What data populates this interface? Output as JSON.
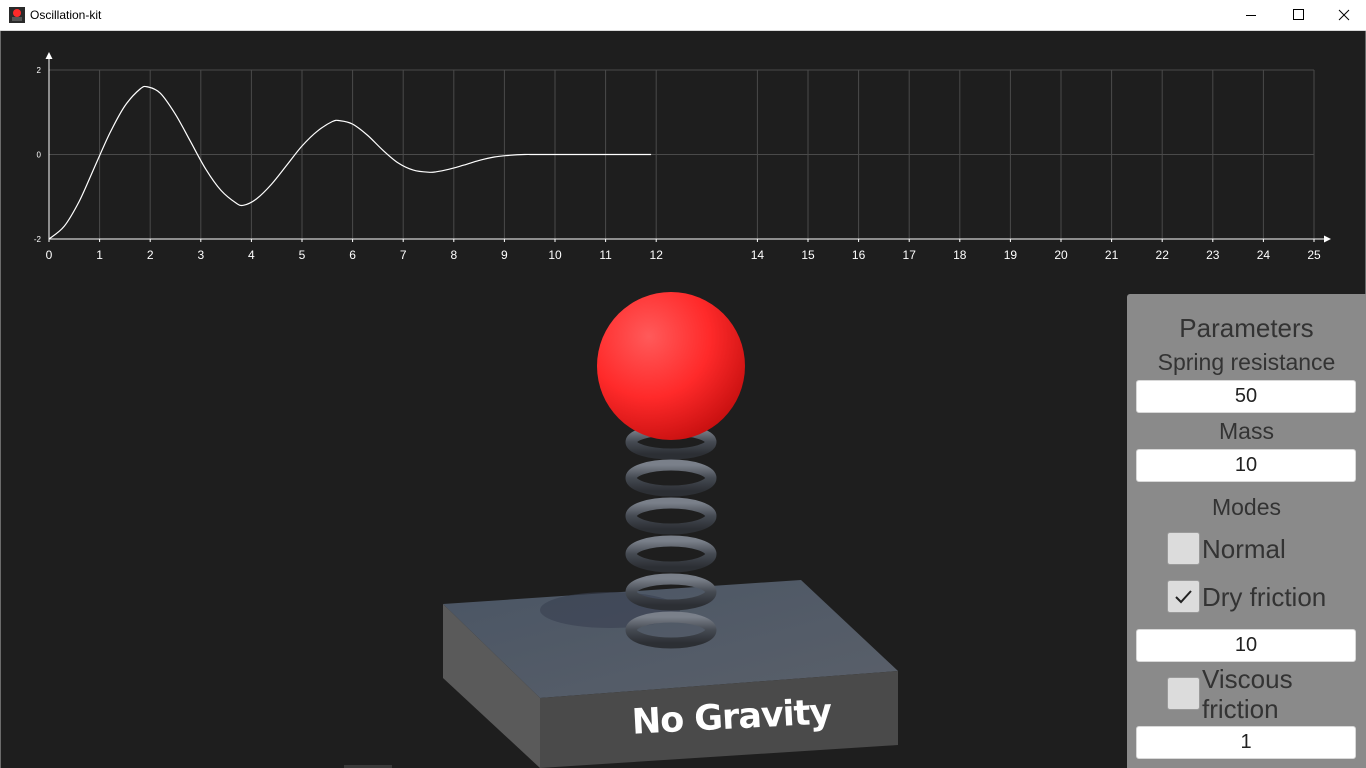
{
  "window": {
    "title": "Oscillation-kit",
    "icon": "red-ball-app-icon",
    "controls": [
      "minimize-icon",
      "maximize-icon",
      "close-icon"
    ]
  },
  "chart_data": {
    "type": "line",
    "title": "",
    "xlabel": "",
    "ylabel": "",
    "xlim": [
      0,
      25
    ],
    "ylim": [
      -2,
      2
    ],
    "x_ticks": [
      "0",
      "1",
      "2",
      "3",
      "4",
      "5",
      "6",
      "7",
      "8",
      "9",
      "10",
      "11",
      "12",
      "14",
      "15",
      "16",
      "17",
      "18",
      "19",
      "20",
      "21",
      "22",
      "23",
      "24",
      "25"
    ],
    "y_ticks": [
      "2",
      "0",
      "-2"
    ],
    "grid": true,
    "series": [
      {
        "color": "#ffffff",
        "x": [
          0,
          0.3,
          0.6,
          0.9,
          1.2,
          1.5,
          1.8,
          1.95,
          2.2,
          2.5,
          2.8,
          3.1,
          3.4,
          3.7,
          3.85,
          4.1,
          4.4,
          4.7,
          5.0,
          5.3,
          5.6,
          5.75,
          6.0,
          6.3,
          6.6,
          6.9,
          7.2,
          7.5,
          7.65,
          7.9,
          8.2,
          8.5,
          8.8,
          9.1,
          9.4,
          9.6,
          10,
          10.5,
          11,
          11.5,
          11.9
        ],
        "y": [
          -2.0,
          -1.7,
          -1.1,
          -0.3,
          0.5,
          1.15,
          1.55,
          1.6,
          1.45,
          0.95,
          0.3,
          -0.35,
          -0.85,
          -1.15,
          -1.2,
          -1.05,
          -0.7,
          -0.25,
          0.2,
          0.55,
          0.78,
          0.8,
          0.72,
          0.45,
          0.1,
          -0.2,
          -0.37,
          -0.42,
          -0.41,
          -0.35,
          -0.25,
          -0.14,
          -0.06,
          -0.02,
          0.0,
          0.0,
          0.0,
          0.0,
          0.0,
          0.0,
          0.0
        ]
      }
    ]
  },
  "scene": {
    "label": "No Gravity",
    "ball_color": "#ff2a2a",
    "spring_color": "#4a4f57",
    "base_color": "#4a4a4a"
  },
  "params": {
    "title": "Parameters",
    "spring_label": "Spring resistance",
    "spring_value": "50",
    "mass_label": "Mass",
    "mass_value": "10",
    "modes_label": "Modes",
    "normal_label": "Normal",
    "normal_checked": false,
    "dry_label": "Dry friction",
    "dry_checked": true,
    "dry_value": "10",
    "viscous_label": "Viscous friction",
    "viscous_checked": false,
    "viscous_value": "1"
  }
}
